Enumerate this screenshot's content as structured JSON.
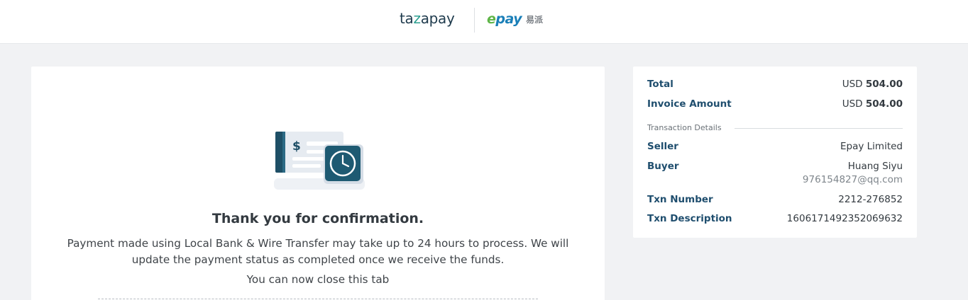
{
  "header": {
    "brand_tazapay_pre": "ta",
    "brand_tazapay_z": "z",
    "brand_tazapay_post": "apay",
    "brand_epay_e": "e",
    "brand_epay_rest": "pay",
    "brand_epay_cn": "易派"
  },
  "confirmation": {
    "title": "Thank you for confirmation.",
    "message": "Payment made using Local Bank & Wire Transfer may take up to 24 hours to process. We will update the payment status as completed once we receive the funds.",
    "close_note": "You can now close this tab",
    "illustration_icon": "bank-transfer-clock-icon"
  },
  "summary": {
    "total_label": "Total",
    "total_currency": "USD",
    "total_amount": "504.00",
    "invoice_label": "Invoice Amount",
    "invoice_currency": "USD",
    "invoice_amount": "504.00",
    "section_title": "Transaction Details",
    "seller_label": "Seller",
    "seller_value": "Epay Limited",
    "buyer_label": "Buyer",
    "buyer_name": "Huang Siyu",
    "buyer_email": "976154827@qq.com",
    "txn_number_label": "Txn Number",
    "txn_number_value": "2212-276852",
    "txn_desc_label": "Txn Description",
    "txn_desc_value": "1606171492352069632"
  },
  "colors": {
    "accent": "#1f4e6e",
    "teal": "#1e5a72",
    "background": "#f1f2f4"
  }
}
